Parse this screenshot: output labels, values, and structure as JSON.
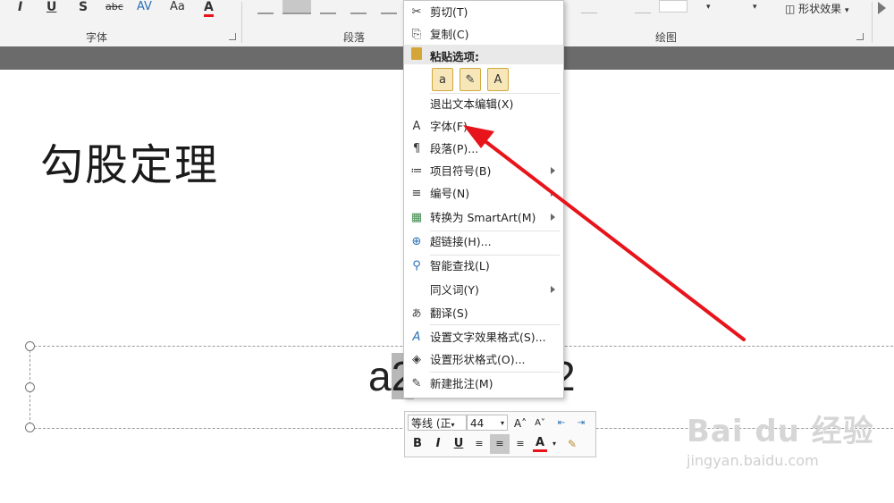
{
  "ribbon": {
    "font_group": {
      "label": "字体",
      "buttons": [
        "I",
        "U",
        "S",
        "abc",
        "AV",
        "Aa",
        "A"
      ]
    },
    "paragraph_group": {
      "label": "段落"
    },
    "drawing_group": {
      "label": "绘图",
      "shape_effects": "形状效果"
    }
  },
  "slide": {
    "title": "勾股定理",
    "formula_left": "a",
    "formula_selected": "2",
    "formula_right": "2"
  },
  "context_menu": {
    "items": [
      {
        "icon": "✂",
        "label": "剪切(T)"
      },
      {
        "icon": "⎘",
        "label": "复制(C)"
      },
      {
        "icon": "",
        "label": "粘贴选项:"
      },
      {
        "icon": "",
        "label": "退出文本编辑(X)"
      },
      {
        "icon": "A",
        "label": "字体(F)..."
      },
      {
        "icon": "¶",
        "label": "段落(P)..."
      },
      {
        "icon": "≔",
        "label": "项目符号(B)"
      },
      {
        "icon": "≡",
        "label": "编号(N)"
      },
      {
        "icon": "▦",
        "label": "转换为 SmartArt(M)"
      },
      {
        "icon": "⊕",
        "label": "超链接(H)..."
      },
      {
        "icon": "⚲",
        "label": "智能查找(L)"
      },
      {
        "icon": "",
        "label": "同义词(Y)"
      },
      {
        "icon": "あ",
        "label": "翻译(S)"
      },
      {
        "icon": "A",
        "label": "设置文字效果格式(S)..."
      },
      {
        "icon": "◈",
        "label": "设置形状格式(O)..."
      },
      {
        "icon": "✎",
        "label": "新建批注(M)"
      }
    ],
    "paste_options": [
      "a",
      "✎",
      "A"
    ]
  },
  "mini_toolbar": {
    "font_name": "等线 (正",
    "font_size": "44",
    "bold": "B",
    "italic": "I",
    "underline": "U",
    "font_color": "A"
  },
  "watermark": {
    "brand": "Bai du 经验",
    "url": "jingyan.baidu.com"
  },
  "colors": {
    "arrow": "#e8141b",
    "accent_gray": "#6b6b6b",
    "font_color_bar": "#e8141b"
  }
}
